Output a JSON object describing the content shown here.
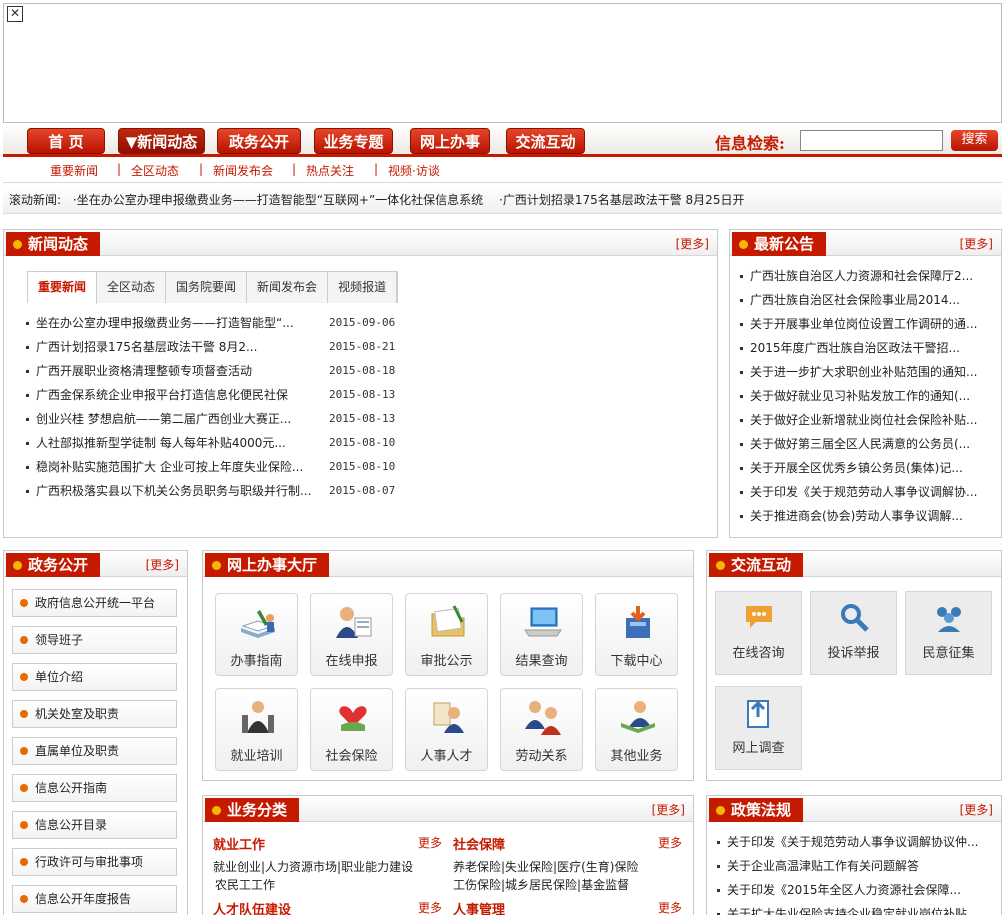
{
  "nav": {
    "items": [
      "首 页",
      "▼新闻动态",
      "政务公开",
      "业务专题",
      "网上办事",
      "交流互动"
    ],
    "search_label": "信息检索:",
    "search_button": "搜索"
  },
  "subnav": [
    "重要新闻",
    "全区动态",
    "新闻发布会",
    "热点关注",
    "视频·访谈"
  ],
  "ticker": {
    "label": "滚动新闻:",
    "items": [
      "·坐在办公室办理申报缴费业务——打造智能型“互联网+”一体化社保信息系统",
      "·广西计划招录175名基层政法干警 8月25日开"
    ]
  },
  "news": {
    "title": "新闻动态",
    "more": "[更多]",
    "tabs": [
      "重要新闻",
      "全区动态",
      "国务院要闻",
      "新闻发布会",
      "视频报道"
    ],
    "items": [
      {
        "text": "坐在办公室办理申报缴费业务——打造智能型“...",
        "date": "2015-09-06"
      },
      {
        "text": "广西计划招录175名基层政法干警 8月2...",
        "date": "2015-08-21"
      },
      {
        "text": "广西开展职业资格清理整顿专项督查活动",
        "date": "2015-08-18"
      },
      {
        "text": "广西金保系统企业申报平台打造信息化便民社保",
        "date": "2015-08-13"
      },
      {
        "text": "创业兴桂 梦想启航——第二届广西创业大赛正...",
        "date": "2015-08-13"
      },
      {
        "text": "人社部拟推新型学徒制 每人每年补贴4000元...",
        "date": "2015-08-10"
      },
      {
        "text": "稳岗补贴实施范围扩大 企业可按上年度失业保险...",
        "date": "2015-08-10"
      },
      {
        "text": "广西积极落实县以下机关公务员职务与职级并行制...",
        "date": "2015-08-07"
      }
    ]
  },
  "notice": {
    "title": "最新公告",
    "more": "[更多]",
    "items": [
      "广西壮族自治区人力资源和社会保障厅2...",
      "广西壮族自治区社会保险事业局2014...",
      "关于开展事业单位岗位设置工作调研的通...",
      "2015年度广西壮族自治区政法干警招...",
      "关于进一步扩大求职创业补贴范围的通知...",
      "关于做好就业见习补贴发放工作的通知(...",
      "关于做好企业新增就业岗位社会保险补贴...",
      "关于做好第三届全区人民满意的公务员(...",
      "关于开展全区优秀乡镇公务员(集体)记...",
      "关于印发《关于规范劳动人事争议调解协...",
      "关于推进商会(协会)劳动人事争议调解..."
    ]
  },
  "gov": {
    "title": "政务公开",
    "more": "[更多]",
    "items": [
      "政府信息公开统一平台",
      "领导班子",
      "单位介绍",
      "机关处室及职责",
      "直属单位及职责",
      "信息公开指南",
      "信息公开目录",
      "行政许可与审批事项",
      "信息公开年度报告"
    ]
  },
  "online": {
    "title": "网上办事大厅",
    "tiles": [
      {
        "label": "办事指南",
        "icon": "guide-icon"
      },
      {
        "label": "在线申报",
        "icon": "declare-icon"
      },
      {
        "label": "审批公示",
        "icon": "approval-icon"
      },
      {
        "label": "结果查询",
        "icon": "query-icon"
      },
      {
        "label": "下载中心",
        "icon": "download-icon"
      },
      {
        "label": "就业培训",
        "icon": "training-icon"
      },
      {
        "label": "社会保险",
        "icon": "insurance-icon"
      },
      {
        "label": "人事人才",
        "icon": "talent-icon"
      },
      {
        "label": "劳动关系",
        "icon": "labor-icon"
      },
      {
        "label": "其他业务",
        "icon": "other-icon"
      }
    ]
  },
  "interact": {
    "title": "交流互动",
    "tiles": [
      {
        "label": "在线咨询",
        "icon": "chat-icon"
      },
      {
        "label": "投诉举报",
        "icon": "report-icon"
      },
      {
        "label": "民意征集",
        "icon": "people-icon"
      },
      {
        "label": "网上调查",
        "icon": "survey-icon"
      }
    ]
  },
  "business": {
    "title": "业务分类",
    "more": "[更多]",
    "cat1": {
      "title": "就业工作",
      "more": "更多",
      "line1": "就业创业|人力资源市场|职业能力建设",
      "line2": "农民工工作"
    },
    "cat2": {
      "title": "社会保障",
      "more": "更多",
      "line1": "养老保险|失业保险|医疗(生育)保险",
      "line2": "工伤保险|城乡居民保险|基金监督"
    },
    "cat3": {
      "title": "人才队伍建设",
      "more": "更多"
    },
    "cat4": {
      "title": "人事管理",
      "more": "更多"
    }
  },
  "policy": {
    "title": "政策法规",
    "more": "[更多]",
    "items": [
      "关于印发《关于规范劳动人事争议调解协议仲...",
      "关于企业高温津贴工作有关问题解答",
      "关于印发《2015年全区人力资源社会保障...",
      "关于扩大失业保险支持企业稳定就业岗位补贴..."
    ]
  },
  "colors": {
    "accent": "#c51a00",
    "bullet": "#f5b800"
  }
}
